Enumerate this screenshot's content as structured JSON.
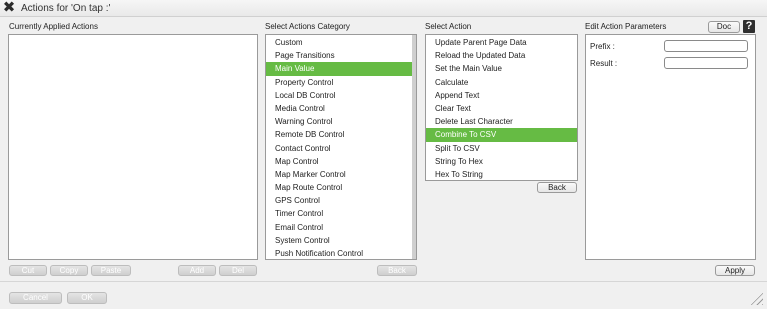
{
  "window": {
    "title": "Actions for 'On tap :'",
    "close_icon": "close-x-icon"
  },
  "applied": {
    "label": "Currently Applied Actions",
    "buttons": {
      "cut": "Cut",
      "copy": "Copy",
      "paste": "Paste",
      "add": "Add",
      "del": "Del"
    }
  },
  "category": {
    "label": "Select Actions Category",
    "items": [
      "Custom",
      "Page Transitions",
      "Main Value",
      "Property Control",
      "Local DB Control",
      "Media Control",
      "Warning Control",
      "Remote DB Control",
      "Contact Control",
      "Map Control",
      "Map Marker Control",
      "Map Route Control",
      "GPS Control",
      "Timer Control",
      "Email Control",
      "System Control",
      "Push Notification Control"
    ],
    "selected": "Main Value",
    "back_label": "Back"
  },
  "action": {
    "label": "Select Action",
    "items": [
      "Update Parent Page Data",
      "Reload the Updated Data",
      "Set the Main Value",
      "Calculate",
      "Append Text",
      "Clear Text",
      "Delete Last Character",
      "Combine To CSV",
      "Split To CSV",
      "String To Hex",
      "Hex To String"
    ],
    "selected": "Combine To CSV",
    "back_label": "Back"
  },
  "params": {
    "label": "Edit Action Parameters",
    "doc_label": "Doc",
    "help_icon": "help-question-icon",
    "prefix_label": "Prefix :",
    "prefix_value": "",
    "result_label": "Result :",
    "result_value": "",
    "apply_label": "Apply"
  },
  "footer": {
    "cancel_label": "Cancel",
    "ok_label": "OK"
  },
  "colors": {
    "selection": "#66bb44",
    "panel_border": "#9a9a9a",
    "background": "#f0f0f0"
  }
}
